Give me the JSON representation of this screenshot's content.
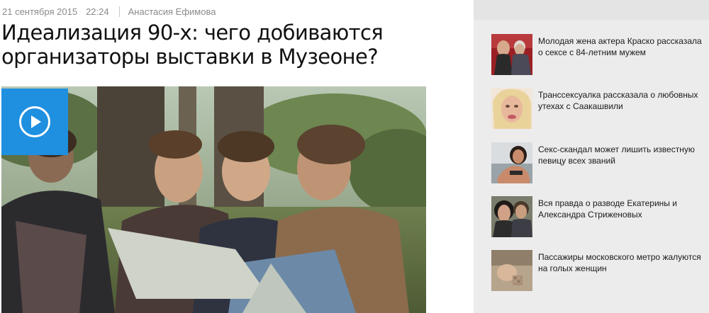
{
  "article": {
    "date": "21 сентября 2015",
    "time": "22:24",
    "author": "Анастасия Ефимова",
    "headline": "Идеализация 90-х: чего добиваются организаторы выставки в Музеоне?",
    "hero_icon": "play-circle-icon",
    "accent_color": "#1f8fe0"
  },
  "sidebar": {
    "background_color": "#ececec",
    "items": [
      {
        "text": "Молодая жена актера Краско рассказала о сексе с 84-летним мужем"
      },
      {
        "text": "Транссексуалка рассказала о любовных утехах с Саакашвили"
      },
      {
        "text": "Секс-скандал может лишить известную певицу всех званий"
      },
      {
        "text": "Вся правда о разводе Екатерины и Александра Стриженовых"
      },
      {
        "text": "Пассажиры московского метро жалуются на голых женщин"
      }
    ]
  }
}
